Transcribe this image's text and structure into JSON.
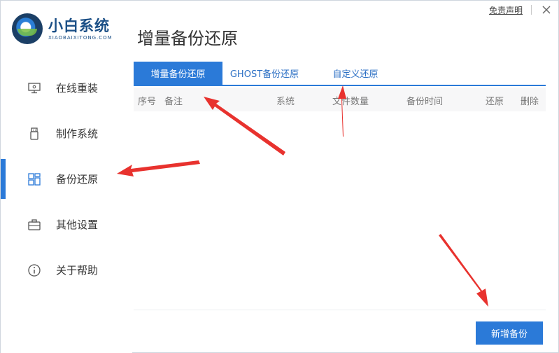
{
  "app": {
    "logo_title": "小白系统",
    "logo_subtitle": "XIAOBAIXITONG.COM"
  },
  "topbar": {
    "disclaimer": "免责声明",
    "close_icon": "close-icon"
  },
  "sidebar": {
    "items": [
      {
        "label": "在线重装",
        "icon": "monitor-icon"
      },
      {
        "label": "制作系统",
        "icon": "usb-icon"
      },
      {
        "label": "备份还原",
        "icon": "grid-icon",
        "active": true
      },
      {
        "label": "其他设置",
        "icon": "briefcase-icon"
      },
      {
        "label": "关于帮助",
        "icon": "info-icon"
      }
    ]
  },
  "main": {
    "title": "增量备份还原",
    "tabs": [
      {
        "label": "增量备份还原",
        "active": true
      },
      {
        "label": "GHOST备份还原"
      },
      {
        "label": "自定义还原"
      }
    ],
    "table": {
      "columns": [
        "序号",
        "备注",
        "系统",
        "文件数量",
        "备份时间",
        "还原",
        "删除"
      ],
      "rows": []
    },
    "new_backup_button": "新增备份"
  },
  "colors": {
    "accent": "#2b7ad8",
    "annotation": "#e8322e"
  }
}
